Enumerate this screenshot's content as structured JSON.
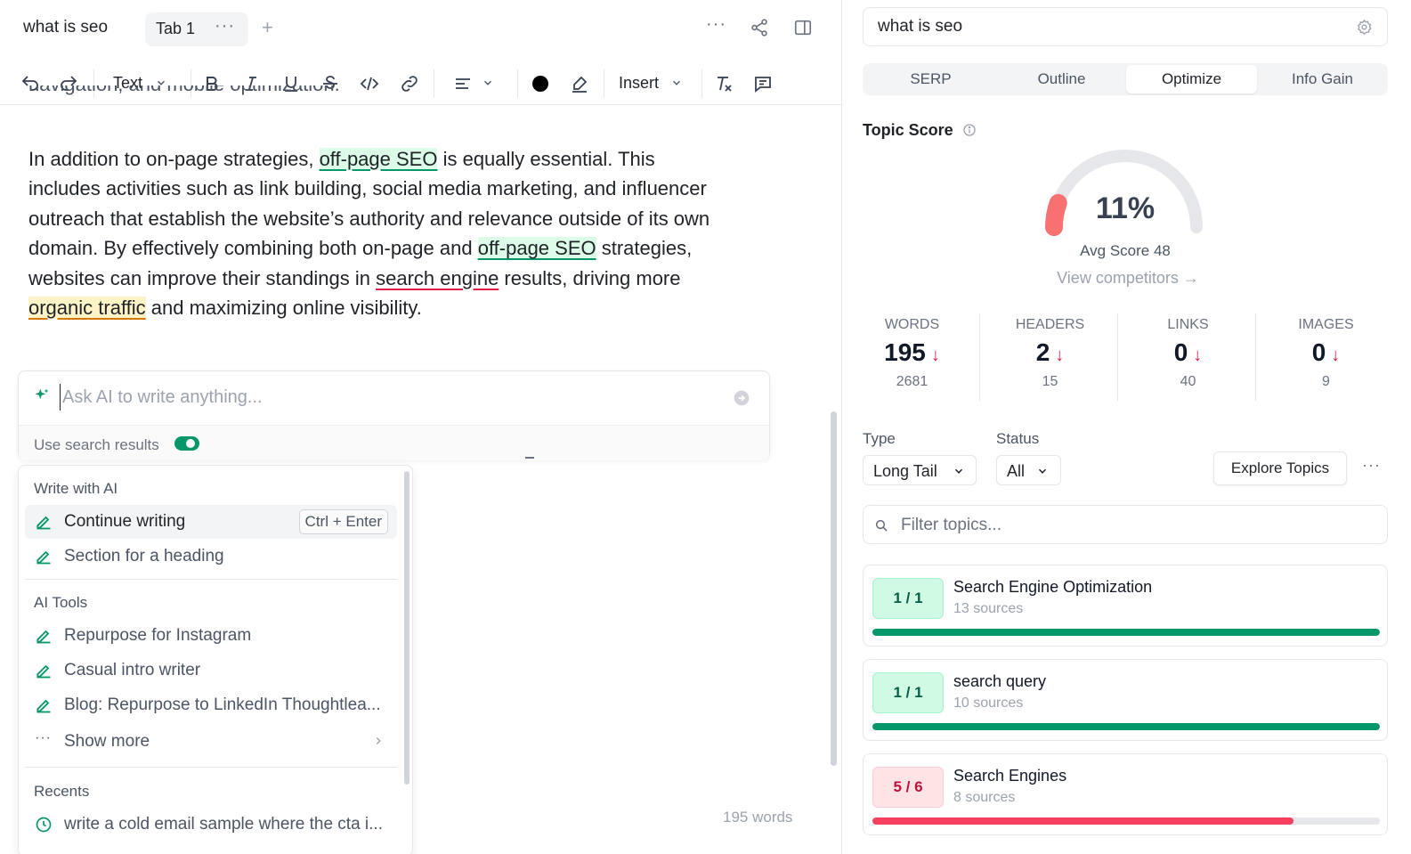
{
  "editor": {
    "doc_title": "what is seo",
    "tab_label": "Tab 1",
    "toolbar": {
      "text_style": "Text",
      "insert": "Insert"
    },
    "cut_line": "navigation, and mobile optimization.",
    "paragraph": {
      "p1": "In addition to on-page strategies, ",
      "t1": "off-page SEO",
      "p2": " is equally essential. This includes activities such as link building, social media marketing, and influencer outreach that establish the website’s authority and relevance outside of its own domain. By effectively combining both on-page and ",
      "t2": "off-page SEO",
      "p3": " strategies, websites can improve their standings in ",
      "t3": "search engine",
      "p4": " results, driving more ",
      "t4": "organic traffic",
      "p5": " and maximizing online visibility."
    },
    "ai": {
      "placeholder": "Ask AI to write anything...",
      "use_search_label": "Use search results",
      "use_search_on": true
    },
    "menu": {
      "write_section": "Write with AI",
      "continue_writing": "Continue writing",
      "continue_shortcut": "Ctrl + Enter",
      "section_heading": "Section for a heading",
      "tools_section": "AI Tools",
      "tools": [
        "Repurpose for Instagram",
        "Casual intro writer",
        "Blog: Repurpose to LinkedIn Thoughtlea..."
      ],
      "show_more": "Show more",
      "recents_section": "Recents",
      "recent_item": "write a cold email sample where the cta i..."
    },
    "word_count": "195 words"
  },
  "panel": {
    "keyword": "what is seo",
    "tabs": [
      "SERP",
      "Outline",
      "Optimize",
      "Info Gain"
    ],
    "active_tab": "Optimize",
    "topic_score_title": "Topic Score",
    "score": "11%",
    "score_fraction": 0.11,
    "avg_score": "Avg Score 48",
    "view_competitors": "View competitors →",
    "stats": [
      {
        "label": "WORDS",
        "value": "195",
        "target": "2681"
      },
      {
        "label": "HEADERS",
        "value": "2",
        "target": "15"
      },
      {
        "label": "LINKS",
        "value": "0",
        "target": "40"
      },
      {
        "label": "IMAGES",
        "value": "0",
        "target": "9"
      }
    ],
    "type_label": "Type",
    "type_value": "Long Tail",
    "status_label": "Status",
    "status_value": "All",
    "explore_topics": "Explore Topics",
    "filter_placeholder": "Filter topics...",
    "topics": [
      {
        "badge": "1 / 1",
        "name": "Search Engine Optimization",
        "sources": "13 sources",
        "progress": 1.0,
        "status": "good"
      },
      {
        "badge": "1 / 1",
        "name": "search query",
        "sources": "10 sources",
        "progress": 1.0,
        "status": "good"
      },
      {
        "badge": "5 / 6",
        "name": "Search Engines",
        "sources": "8 sources",
        "progress": 0.83,
        "status": "bad"
      }
    ],
    "colors": {
      "accent_green": "#059669",
      "bar_green": "#059669",
      "bar_red": "#f43f5e",
      "gauge_red": "#f87171"
    }
  }
}
